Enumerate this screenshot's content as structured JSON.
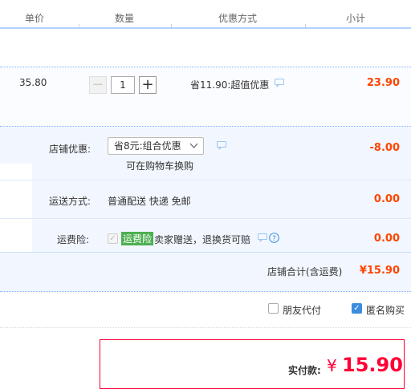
{
  "header": {
    "col_price": "单价",
    "col_qty": "数量",
    "col_promo": "优惠方式",
    "col_subtotal": "小计"
  },
  "item": {
    "unit_price": "35.80",
    "qty": "1",
    "qty_minus": "−",
    "qty_plus": "+",
    "promo": "省11.90:超值优惠",
    "subtotal": "23.90"
  },
  "shop": {
    "discount_label": "店铺优惠:",
    "discount_select": "省8元:组合优惠",
    "discount_note": "可在购物车换购",
    "discount_amount": "-8.00",
    "shipping_label": "运送方式:",
    "shipping_value": "普通配送 快递 免邮",
    "shipping_amount": "0.00",
    "insurance_label": "运费险:",
    "insurance_tag": "运费险",
    "insurance_text": "卖家赠送，退换货可赔",
    "insurance_amount": "0.00",
    "total_label": "店铺合计(含运费)",
    "total_amount": "¥15.90"
  },
  "options": {
    "friend_pay": "朋友代付",
    "friend_pay_checked": false,
    "anonymous": "匿名购买",
    "anonymous_checked": true
  },
  "payment": {
    "label": "实付款:",
    "currency": "¥",
    "amount": "15.90"
  },
  "colors": {
    "accent_red": "#ff0036",
    "price_red": "#f40",
    "blue": "#3c8dde",
    "tag_green": "#4caf50"
  }
}
